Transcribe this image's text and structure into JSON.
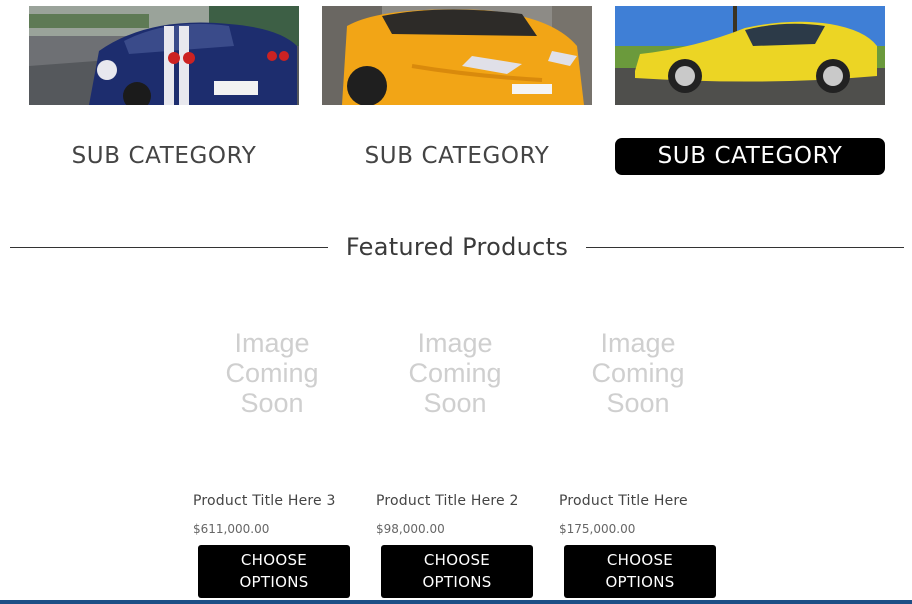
{
  "subcategories": [
    {
      "label": "SUB CATEGORY",
      "active": false,
      "image": "blue-sports-car-photo"
    },
    {
      "label": "SUB CATEGORY",
      "active": false,
      "image": "orange-sports-car-photo"
    },
    {
      "label": "SUB CATEGORY",
      "active": true,
      "image": "yellow-sports-car-photo"
    }
  ],
  "featured": {
    "title": "Featured Products"
  },
  "products": [
    {
      "placeholder": [
        "Image",
        "Coming",
        "Soon"
      ],
      "title": "Product Title Here 3",
      "price": "$611,000.00",
      "button": [
        "CHOOSE",
        "OPTIONS"
      ]
    },
    {
      "placeholder": [
        "Image",
        "Coming",
        "Soon"
      ],
      "title": "Product Title Here 2",
      "price": "$98,000.00",
      "button": [
        "CHOOSE",
        "OPTIONS"
      ]
    },
    {
      "placeholder": [
        "Image",
        "Coming",
        "Soon"
      ],
      "title": "Product Title Here",
      "price": "$175,000.00",
      "button": [
        "CHOOSE",
        "OPTIONS"
      ]
    }
  ],
  "colors": {
    "accent": "#000000",
    "active_text": "#ffffff",
    "placeholder": "#cfcfcf",
    "bottom_bar": "#1d4f86"
  }
}
